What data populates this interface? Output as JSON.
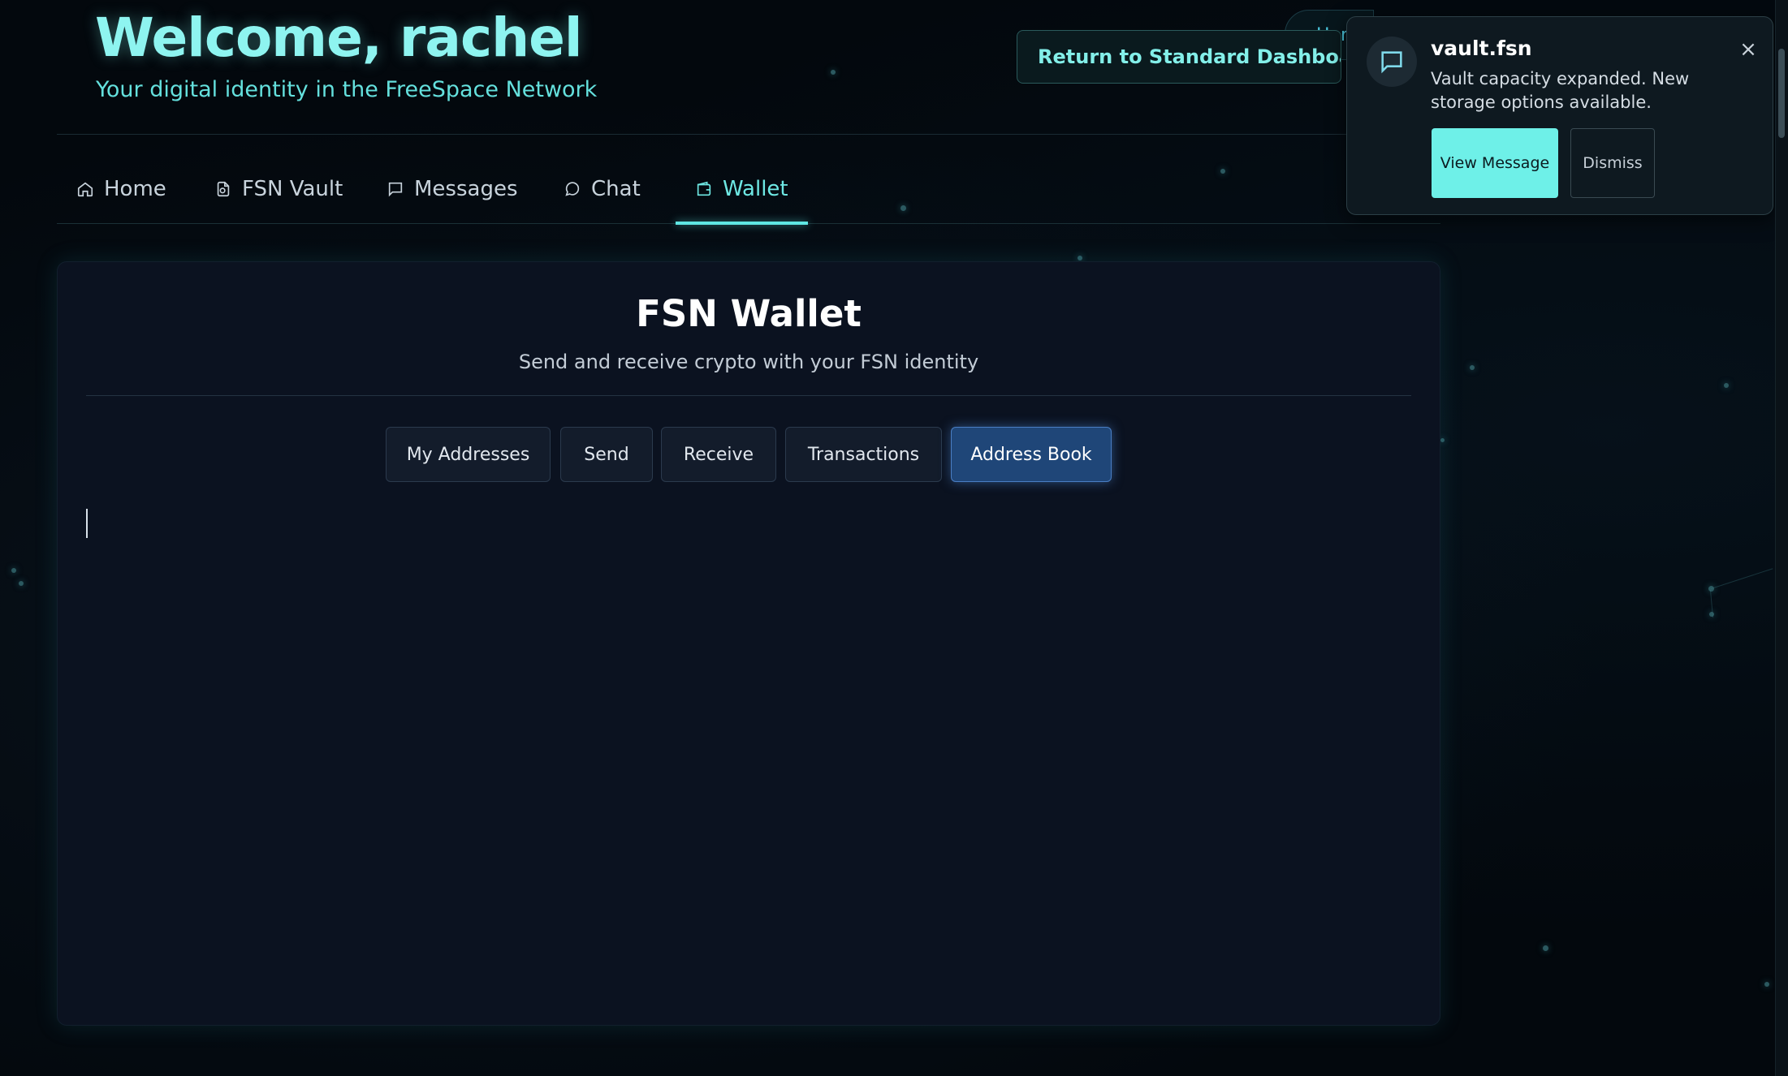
{
  "header": {
    "welcome": "Welcome, rachel",
    "subtitle": "Your digital identity in the FreeSpace Network",
    "return_button": "Return to Standard Dashboard",
    "home_pill": "Hom"
  },
  "nav": {
    "items": [
      {
        "label": "Home",
        "icon": "home-icon"
      },
      {
        "label": "FSN Vault",
        "icon": "vault-file-icon"
      },
      {
        "label": "Messages",
        "icon": "message-square-icon"
      },
      {
        "label": "Chat",
        "icon": "chat-bubble-icon"
      },
      {
        "label": "Wallet",
        "icon": "wallet-icon"
      }
    ],
    "active": "Wallet"
  },
  "wallet": {
    "title": "FSN Wallet",
    "subtitle": "Send and receive crypto with your FSN identity",
    "tabs": [
      "My Addresses",
      "Send",
      "Receive",
      "Transactions",
      "Address Book"
    ],
    "active_tab": "Address Book"
  },
  "notification": {
    "title": "vault.fsn",
    "body": "Vault capacity expanded. New storage options available.",
    "view_button": "View Message",
    "dismiss_button": "Dismiss",
    "close_glyph": "×",
    "icon": "message-icon"
  },
  "colors": {
    "accent": "#6ef0e8",
    "active_tab": "#1f4678",
    "background": "#03080d",
    "panel": "#0b1220"
  }
}
